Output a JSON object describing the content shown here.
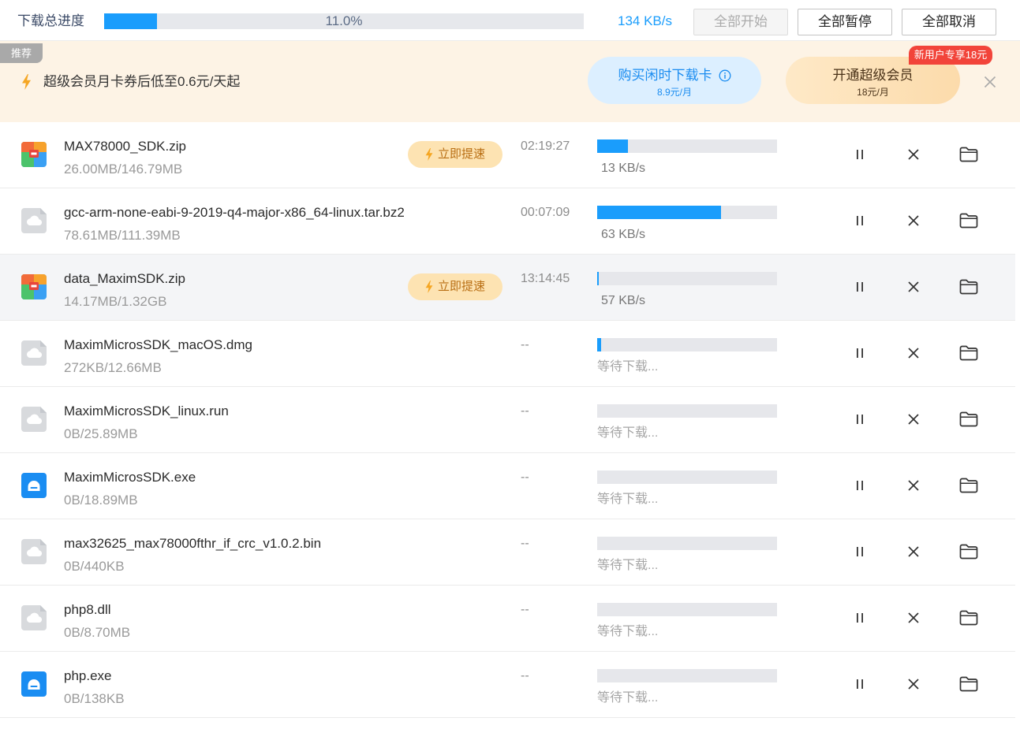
{
  "header": {
    "title": "下载总进度",
    "progress": 0.11,
    "progress_text": "11.0%",
    "speed": "134 KB/s",
    "start_all": {
      "label": "全部开始",
      "disabled": true
    },
    "pause_all": {
      "label": "全部暂停"
    },
    "cancel_all": {
      "label": "全部取消"
    }
  },
  "promo": {
    "tag": "推荐",
    "text": "超级会员月卡券后低至0.6元/天起",
    "idle_card_button": {
      "label": "购买闲时下载卡",
      "price": "8.9元/月"
    },
    "vip_button": {
      "label": "开通超级会员",
      "price": "18元/月",
      "badge": "新用户专享18元"
    }
  },
  "boost_label": "立即提速",
  "colors": {
    "accent": "#1a9dfc",
    "promo_bg": "#fdf3e5",
    "badge_red": "#f2443a",
    "boost_bg": "#fde3b2"
  },
  "downloads": [
    {
      "name": "MAX78000_SDK.zip",
      "size": "26.00MB/146.79MB",
      "icon": "archive-icon",
      "boost": true,
      "time": "02:19:27",
      "progress": 0.17,
      "speed": "13 KB/s",
      "waiting": false
    },
    {
      "name": "gcc-arm-none-eabi-9-2019-q4-major-x86_64-linux.tar.bz2",
      "size": "78.61MB/111.39MB",
      "icon": "cloud-file-icon",
      "boost": false,
      "time": "00:07:09",
      "progress": 0.69,
      "speed": "63 KB/s",
      "waiting": false
    },
    {
      "name": "data_MaximSDK.zip",
      "size": "14.17MB/1.32GB",
      "icon": "archive-icon",
      "boost": true,
      "time": "13:14:45",
      "progress": 0.01,
      "speed": "57 KB/s",
      "waiting": false,
      "highlighted": true
    },
    {
      "name": "MaximMicrosSDK_macOS.dmg",
      "size": "272KB/12.66MB",
      "icon": "cloud-file-icon",
      "boost": false,
      "time": "--",
      "progress": 0.02,
      "speed": "等待下载...",
      "waiting": true
    },
    {
      "name": "MaximMicrosSDK_linux.run",
      "size": "0B/25.89MB",
      "icon": "cloud-file-icon",
      "boost": false,
      "time": "--",
      "progress": 0,
      "speed": "等待下载...",
      "waiting": true
    },
    {
      "name": "MaximMicrosSDK.exe",
      "size": "0B/18.89MB",
      "icon": "installer-icon",
      "boost": false,
      "time": "--",
      "progress": 0,
      "speed": "等待下载...",
      "waiting": true
    },
    {
      "name": "max32625_max78000fthr_if_crc_v1.0.2.bin",
      "size": "0B/440KB",
      "icon": "cloud-file-icon",
      "boost": false,
      "time": "--",
      "progress": 0,
      "speed": "等待下载...",
      "waiting": true
    },
    {
      "name": "php8.dll",
      "size": "0B/8.70MB",
      "icon": "cloud-file-icon",
      "boost": false,
      "time": "--",
      "progress": 0,
      "speed": "等待下载...",
      "waiting": true
    },
    {
      "name": "php.exe",
      "size": "0B/138KB",
      "icon": "installer-icon",
      "boost": false,
      "time": "--",
      "progress": 0,
      "speed": "等待下载...",
      "waiting": true
    }
  ]
}
